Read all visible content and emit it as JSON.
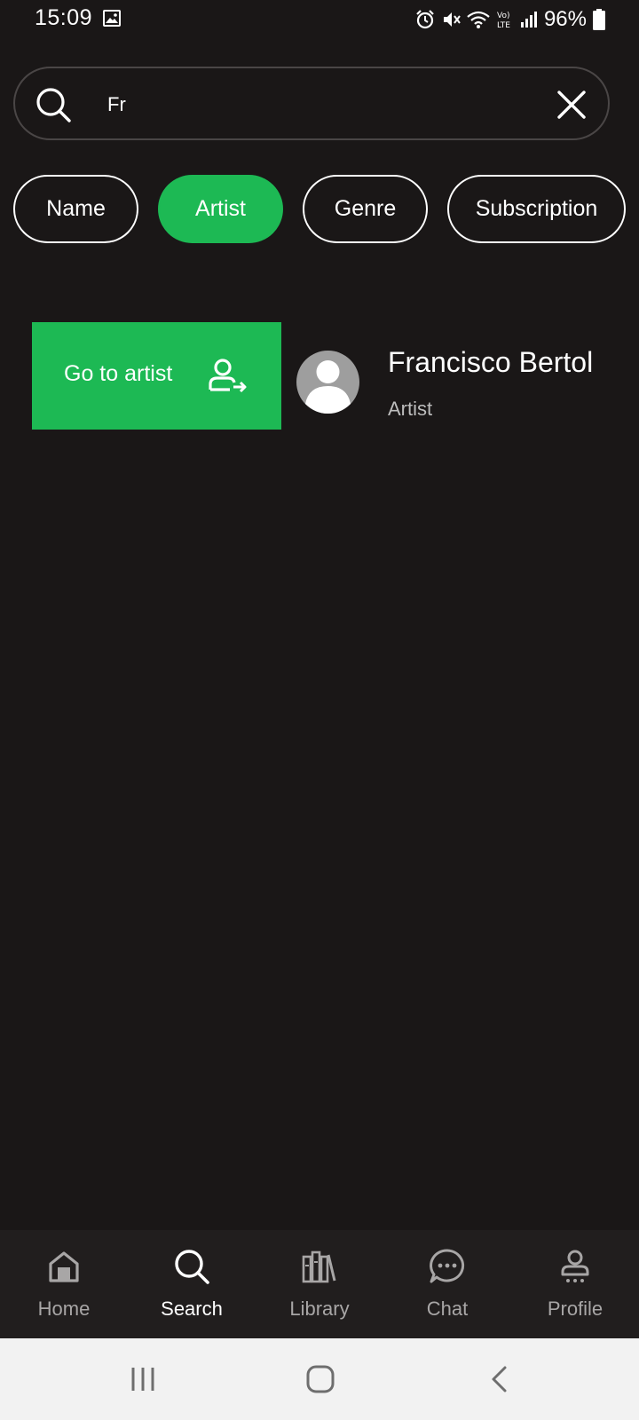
{
  "status_bar": {
    "time": "15:09",
    "battery": "96%"
  },
  "search": {
    "value": "Fr"
  },
  "filters": [
    {
      "label": "Name",
      "active": false
    },
    {
      "label": "Artist",
      "active": true
    },
    {
      "label": "Genre",
      "active": false
    },
    {
      "label": "Subscription",
      "active": false
    }
  ],
  "result": {
    "action_label": "Go to artist",
    "name": "Francisco Bertol",
    "type": "Artist"
  },
  "bottom_nav": [
    {
      "label": "Home",
      "icon": "home-icon",
      "active": false
    },
    {
      "label": "Search",
      "icon": "search-icon",
      "active": true
    },
    {
      "label": "Library",
      "icon": "library-icon",
      "active": false
    },
    {
      "label": "Chat",
      "icon": "chat-icon",
      "active": false
    },
    {
      "label": "Profile",
      "icon": "profile-icon",
      "active": false
    }
  ],
  "colors": {
    "accent": "#1db954",
    "background": "#1a1717",
    "nav_background": "#211e1e"
  }
}
